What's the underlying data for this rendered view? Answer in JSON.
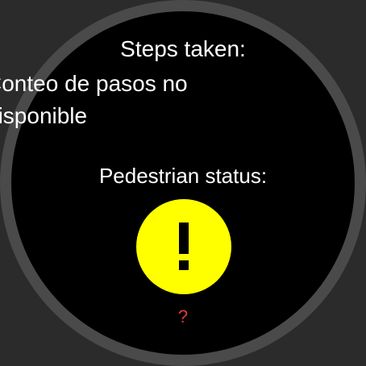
{
  "steps": {
    "label": "Steps taken:",
    "value": "Conteo de pasos no disponible"
  },
  "pedestrian": {
    "label": "Pedestrian status:",
    "status_icon": "exclamation-icon",
    "status_text": "?",
    "colors": {
      "circle": "#ffff00",
      "icon": "#000000",
      "status_text": "#e53935"
    }
  }
}
